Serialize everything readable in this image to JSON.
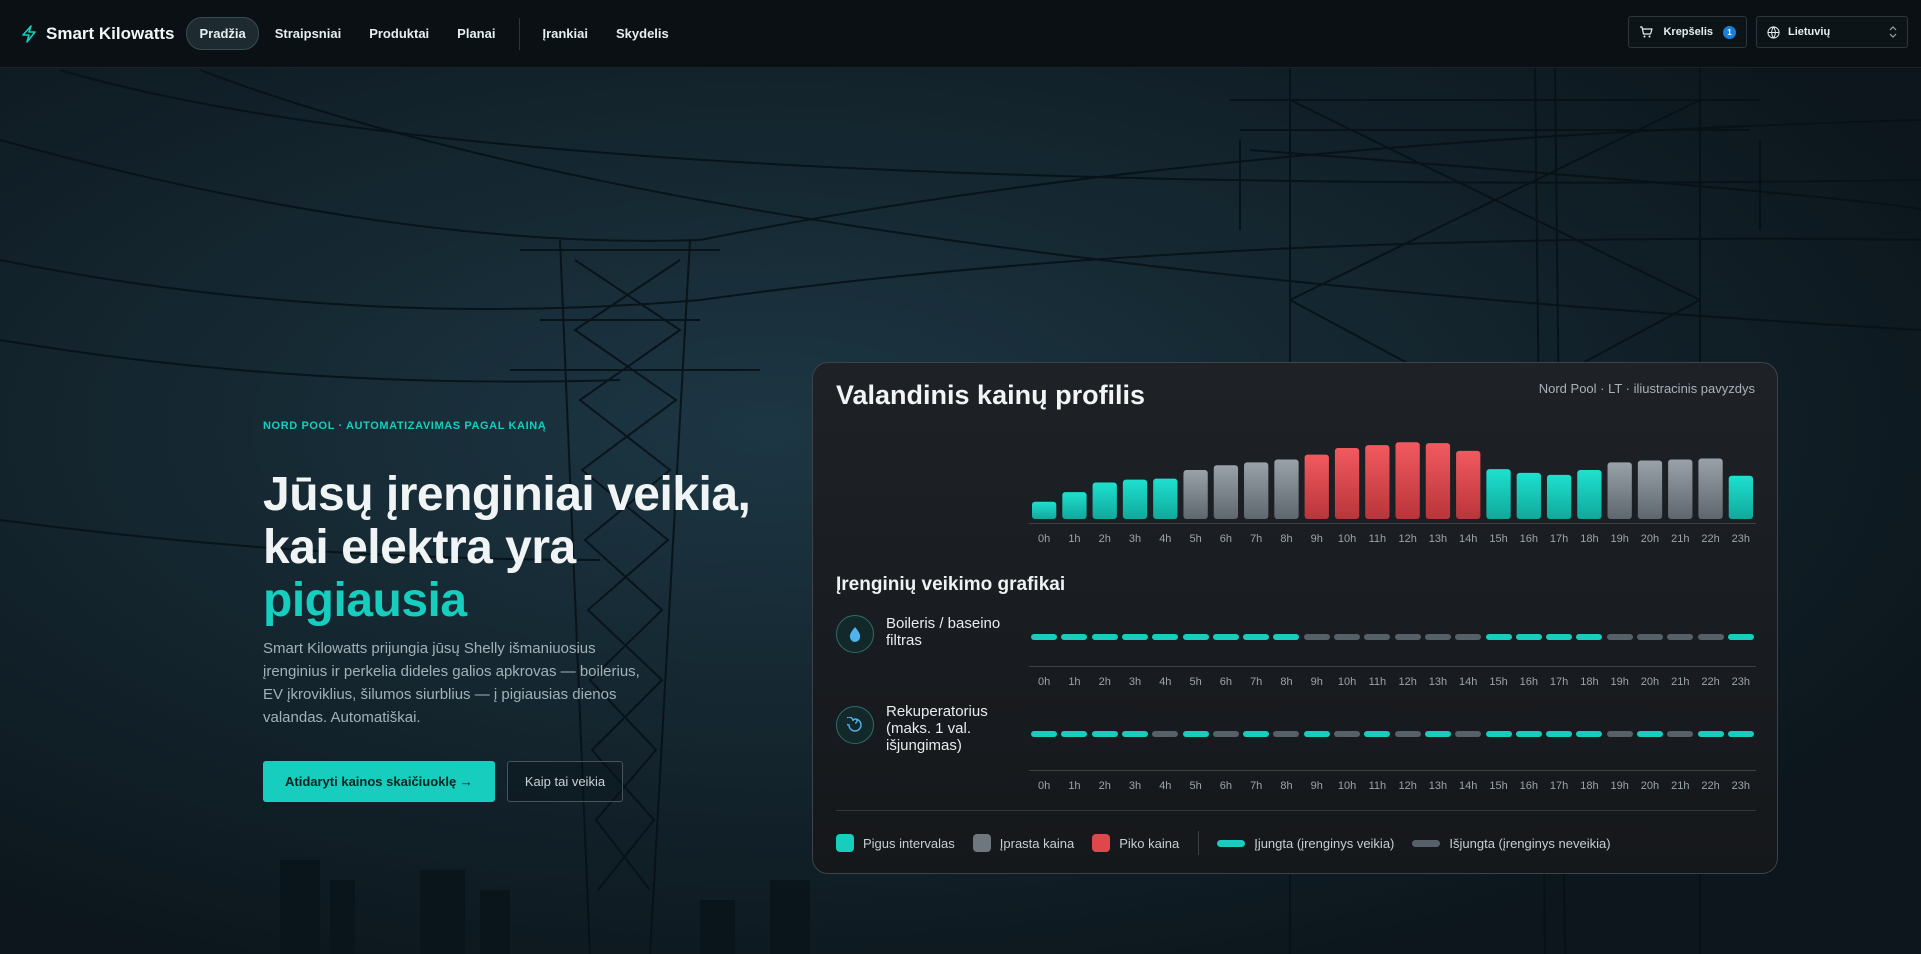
{
  "brand": {
    "name": "Smart Kilowatts",
    "icon": "bolt-icon"
  },
  "nav": {
    "links": [
      {
        "label": "Pradžia",
        "active": true
      },
      {
        "label": "Straipsniai",
        "active": false
      },
      {
        "label": "Produktai",
        "active": false
      },
      {
        "label": "Planai",
        "active": false
      },
      {
        "label": "Įrankiai",
        "active": false
      },
      {
        "label": "Skydelis",
        "active": false
      }
    ],
    "cart": {
      "label": "Krepšelis",
      "count": "1",
      "icon": "cart-icon"
    },
    "language": {
      "label": "Lietuvių",
      "icon": "globe-icon"
    }
  },
  "hero": {
    "eyebrow": "NORD POOL · AUTOMATIZAVIMAS PAGAL KAINĄ",
    "headline_line1": "Jūsų įrenginiai veikia,",
    "headline_line2": "kai elektra yra",
    "headline_accent": "pigiausia",
    "description": "Smart Kilowatts prijungia jūsų Shelly išmaniuosius įrenginius ir perkelia dideles galios apkrovas — boilerius, EV įkroviklius, šilumos siurblius — į pigiausias dienos valandas. Automatiškai.",
    "cta_primary": "Atidaryti kainos skaičiuoklę →",
    "cta_secondary": "Kaip tai veikia"
  },
  "card": {
    "title": "Valandinis kainų profilis",
    "note": "Nord Pool · LT · iliustracinis pavyzdys",
    "section_title": "Įrenginių veikimo grafikai",
    "devices": [
      {
        "label": "Boileris / baseino filtras",
        "icon": "water-drop-icon"
      },
      {
        "label": "Rekuperatorius (maks. 1 val. išjungimas)",
        "icon": "fan-swirl-icon"
      }
    ],
    "legend": {
      "cheap": "Pigus intervalas",
      "normal": "Įprasta kaina",
      "peak": "Piko kaina",
      "on": "Įjungta (įrenginys veikia)",
      "off": "Išjungta (įrenginys neveikia)"
    }
  },
  "colors": {
    "accent": "#17cdbd",
    "cheap": "#17cdbd",
    "normal": "#8a9299",
    "peak": "#e0474c",
    "off": "#566068"
  },
  "chart_data": {
    "type": "bar",
    "categories": [
      "0h",
      "1h",
      "2h",
      "3h",
      "4h",
      "5h",
      "6h",
      "7h",
      "8h",
      "9h",
      "10h",
      "11h",
      "12h",
      "13h",
      "14h",
      "15h",
      "16h",
      "17h",
      "18h",
      "19h",
      "20h",
      "21h",
      "22h",
      "23h"
    ],
    "values": [
      0.18,
      0.28,
      0.38,
      0.41,
      0.42,
      0.51,
      0.56,
      0.59,
      0.62,
      0.67,
      0.74,
      0.77,
      0.8,
      0.79,
      0.71,
      0.52,
      0.48,
      0.46,
      0.51,
      0.59,
      0.61,
      0.62,
      0.63,
      0.45
    ],
    "price_levels": [
      "cheap",
      "cheap",
      "cheap",
      "cheap",
      "cheap",
      "normal",
      "normal",
      "normal",
      "normal",
      "peak",
      "peak",
      "peak",
      "peak",
      "peak",
      "peak",
      "cheap",
      "cheap",
      "cheap",
      "cheap",
      "normal",
      "normal",
      "normal",
      "normal",
      "cheap"
    ],
    "schedules": [
      {
        "states": [
          1,
          1,
          1,
          1,
          1,
          1,
          1,
          1,
          1,
          0,
          0,
          0,
          0,
          0,
          0,
          1,
          1,
          1,
          1,
          0,
          0,
          0,
          0,
          1
        ]
      },
      {
        "states": [
          1,
          1,
          1,
          1,
          0,
          1,
          0,
          1,
          0,
          1,
          0,
          1,
          0,
          1,
          0,
          1,
          1,
          1,
          1,
          0,
          1,
          0,
          1,
          1
        ]
      }
    ],
    "ylim": [
      0,
      1
    ]
  }
}
